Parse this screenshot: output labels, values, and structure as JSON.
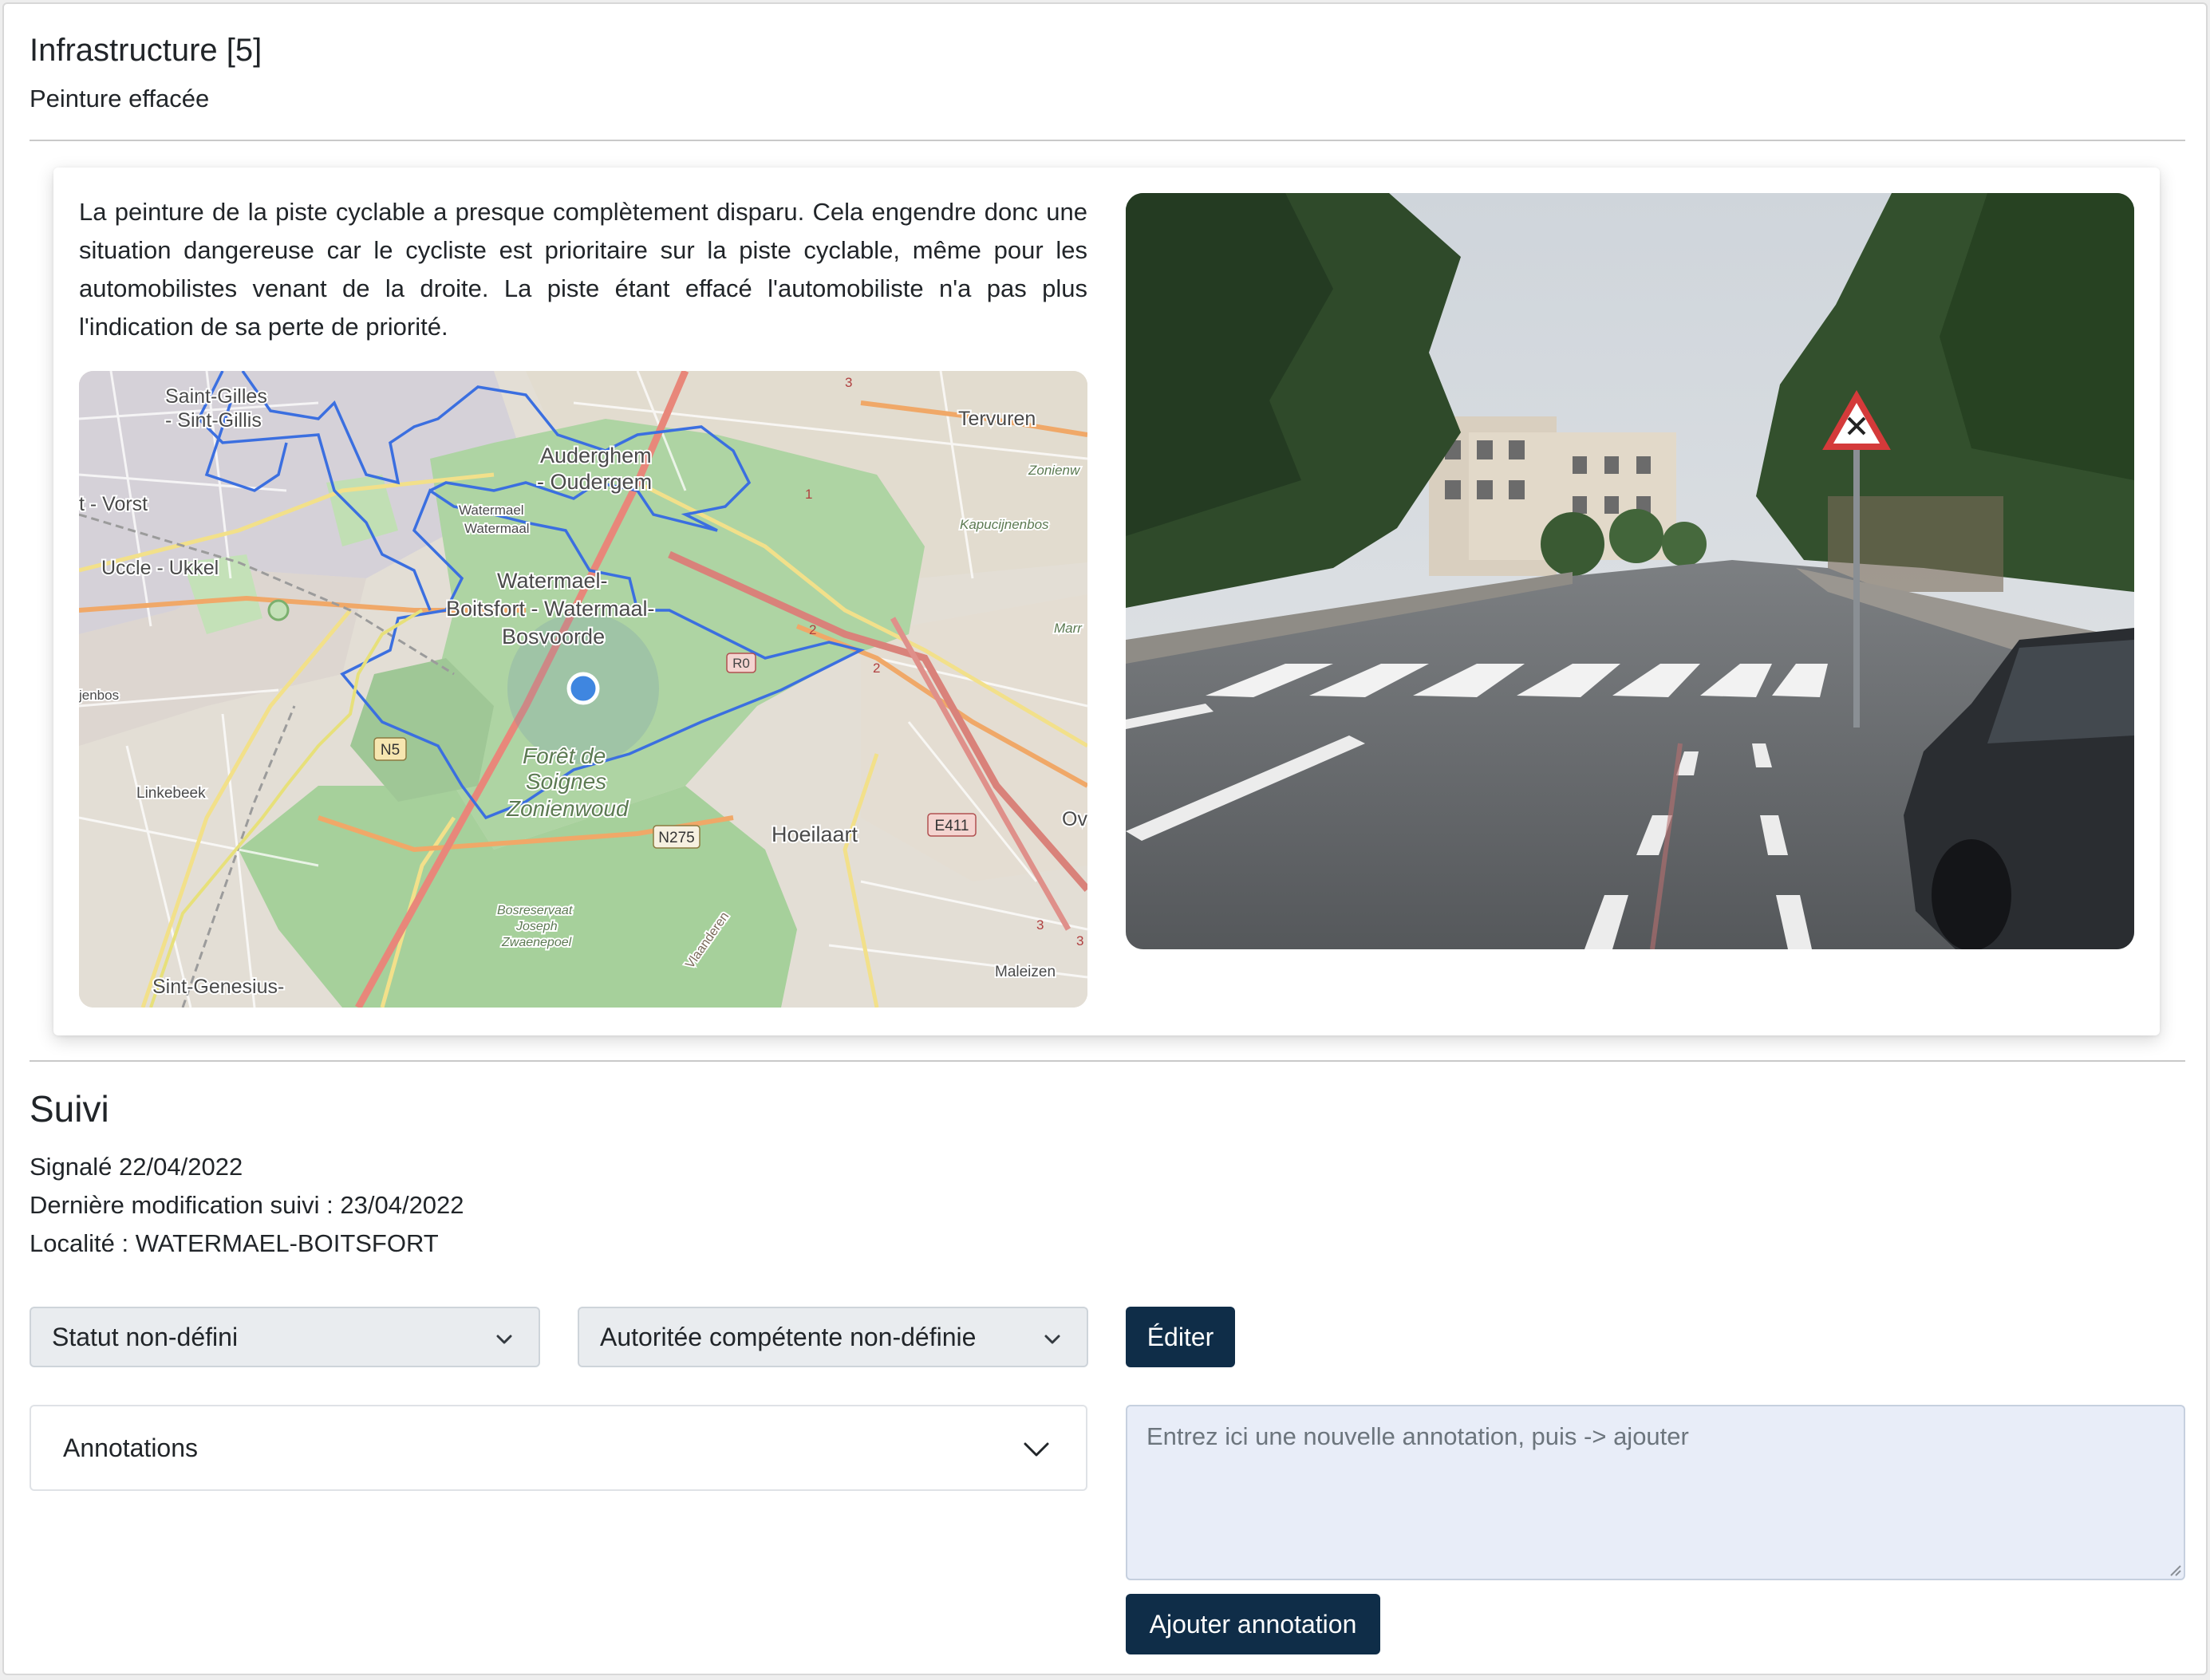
{
  "header": {
    "category": "Infrastructure",
    "count": "[5]",
    "title_full": "Infrastructure [5]",
    "subtitle": "Peinture effacée"
  },
  "report": {
    "description": "La peinture de la piste cyclable a presque complètement disparu. Cela engendre donc une situation dangereuse car le cycliste est prioritaire sur la piste cyclable, même pour les automobilistes venant de la droite. La piste étant effacé l'automobiliste n'a pas plus l'indication de sa perte de priorité."
  },
  "map": {
    "labels": {
      "saint_gilles": "Saint-Gilles",
      "sint_gillis": "- Sint-Gillis",
      "vorst": "t - Vorst",
      "uccle": "Uccle - Ukkel",
      "jenbos": "jenbos",
      "linkebeek": "Linkebeek",
      "sint_genesius": "Sint-Genesius-",
      "tervuren": "Tervuren",
      "zonienw": "Zonienw",
      "auderghem": "Auderghem",
      "oudergem": "- Oudergem",
      "wm_small1": "Watermael",
      "wm_small2": "Watermaal",
      "watermael": "Watermael-",
      "boitsfort": "Boitsfort - Watermaal-",
      "bosvoorde": "Bosvoorde",
      "kapucijnenbos": "Kapucijnenbos",
      "marr": "Marr",
      "foret1": "Forêt de",
      "foret2": "Soignes",
      "foret3": "Zonienwoud",
      "hoeilaart": "Hoeilaart",
      "ov": "Ov",
      "bosreservaat1": "Bosreservaat",
      "bosreservaat2": "Joseph",
      "bosreservaat3": "Zwaenepoel",
      "vlaanderen": "Vlaanderen",
      "maleizen": "Maleizen",
      "r_n5": "N5",
      "r_n275": "N275",
      "r_e411": "E411",
      "r_r0": "R0",
      "r_1": "1",
      "r_2": "2",
      "r_3": "3"
    }
  },
  "tracking": {
    "heading": "Suivi",
    "reported": "Signalé 22/04/2022",
    "last_modified": "Dernière modification suivi : 23/04/2022",
    "locality": "Localité : WATERMAEL-BOITSFORT"
  },
  "controls": {
    "status_select": "Statut non-défini",
    "authority_select": "Autoritée compétente non-définie",
    "edit_button": "Éditer",
    "annotations_label": "Annotations",
    "annotation_placeholder": "Entrez ici une nouvelle annotation, puis -> ajouter",
    "add_annotation_button": "Ajouter annotation"
  },
  "colors": {
    "primary": "#0f2d48",
    "boundary": "#3b6fe0",
    "marker": "#3f86e0",
    "forest": "#a9d4a0"
  }
}
